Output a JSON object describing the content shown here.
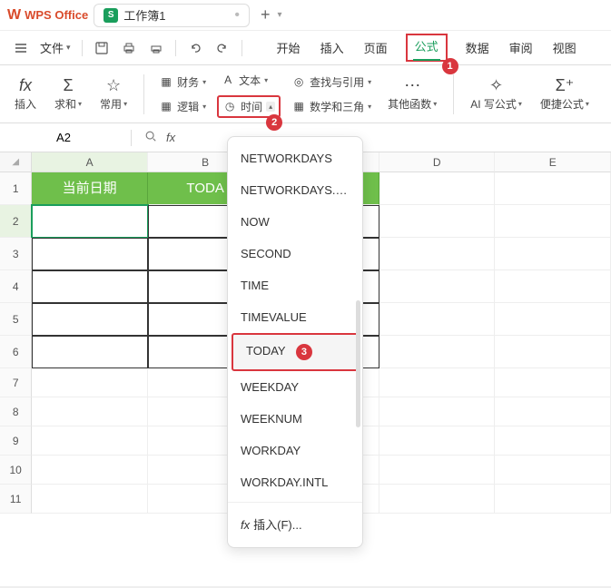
{
  "titlebar": {
    "app": "WPS Office",
    "doc": "工作簿1"
  },
  "menubar": {
    "file": "文件",
    "tabs": [
      "开始",
      "插入",
      "页面",
      "公式",
      "数据",
      "审阅",
      "视图"
    ],
    "active": "公式"
  },
  "ribbon": {
    "insert": "插入",
    "sum": "求和",
    "common": "常用",
    "finance": "财务",
    "logic": "逻辑",
    "text": "文本",
    "time": "时间",
    "lookup": "查找与引用",
    "math": "数学和三角",
    "more": "其他函数",
    "ai": "AI 写公式",
    "quick": "便捷公式"
  },
  "namebox": "A2",
  "fx": "fx",
  "sheet": {
    "cols": [
      "A",
      "B",
      "",
      "D",
      "E"
    ],
    "rows": [
      "1",
      "2",
      "3",
      "4",
      "5",
      "6",
      "7",
      "8",
      "9",
      "10",
      "11"
    ],
    "headerA": "当前日期",
    "headerB": "TODA"
  },
  "dropdown": {
    "items": [
      "NETWORKDAYS",
      "NETWORKDAYS.IN...",
      "NOW",
      "SECOND",
      "TIME",
      "TIMEVALUE",
      "TODAY",
      "WEEKDAY",
      "WEEKNUM",
      "WORKDAY",
      "WORKDAY.INTL"
    ],
    "insertF": "插入(F)..."
  },
  "annot": {
    "a1": "1",
    "a2": "2",
    "a3": "3"
  }
}
